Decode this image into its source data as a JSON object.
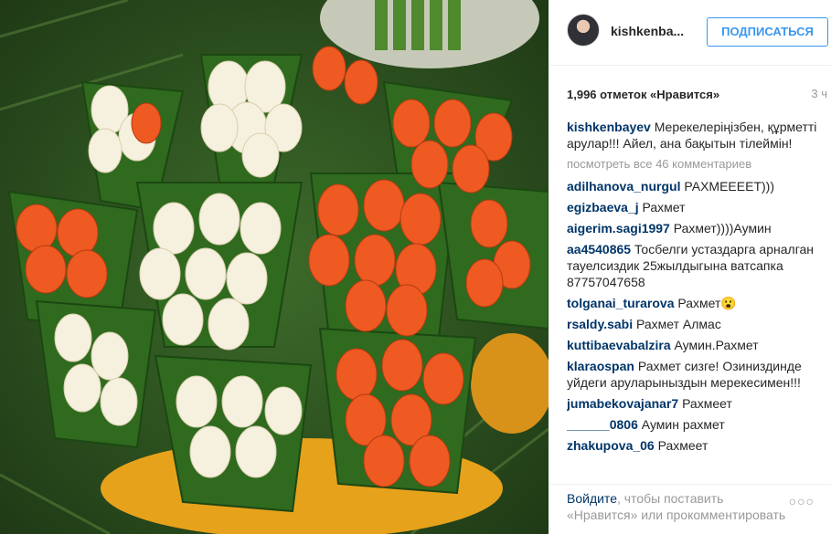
{
  "post": {
    "image_icon": "bouquet-photo"
  },
  "header": {
    "username": "kishkenba...",
    "follow_label": "ПОДПИСАТЬСЯ",
    "avatar_icon": "avatar"
  },
  "meta": {
    "likes": "1,996 отметок «Нравится»",
    "time": "3 ч"
  },
  "caption": {
    "user": "kishkenbayev",
    "text": "Мерекелеріңізбен, құрметті арулар!!! Айел, ана бақытын тілеймін!"
  },
  "more_comments": "посмотреть все 46 комментариев",
  "comments": [
    {
      "user": "adilhanova_nurgul",
      "text": "РАХМЕЕЕЕТ)))"
    },
    {
      "user": "egizbaeva_j",
      "text": "Рахмет"
    },
    {
      "user": "aigerim.sagi1997",
      "text": "Рахмет))))Аумин"
    },
    {
      "user": "aa4540865",
      "text": "Тосбелги устаздарга арналган тауелсиздик 25жылдыгына ватсапка 87757047658"
    },
    {
      "user": "tolganai_turarova",
      "text": "Рахмет😮"
    },
    {
      "user": "rsaldy.sabi",
      "text": "Рахмет Алмас"
    },
    {
      "user": "kuttibaevabalzira",
      "text": "Аумин.Рахмет"
    },
    {
      "user": "klaraospan",
      "text": "Рахмет сизге! Озиниздинде уйдеги аруларыныздын мерекесимен!!!"
    },
    {
      "user": "jumabekovajanar7",
      "text": "Рахмеет"
    },
    {
      "user": "______0806",
      "text": "Аумин рахмет"
    },
    {
      "user": "zhakupova_06",
      "text": "Рахмеет"
    }
  ],
  "footer": {
    "login_link": "Войдите",
    "text": ", чтобы поставить «Нравится» или прокомментировать",
    "more_icon": "more-options-icon",
    "more_glyph": "○○○"
  }
}
